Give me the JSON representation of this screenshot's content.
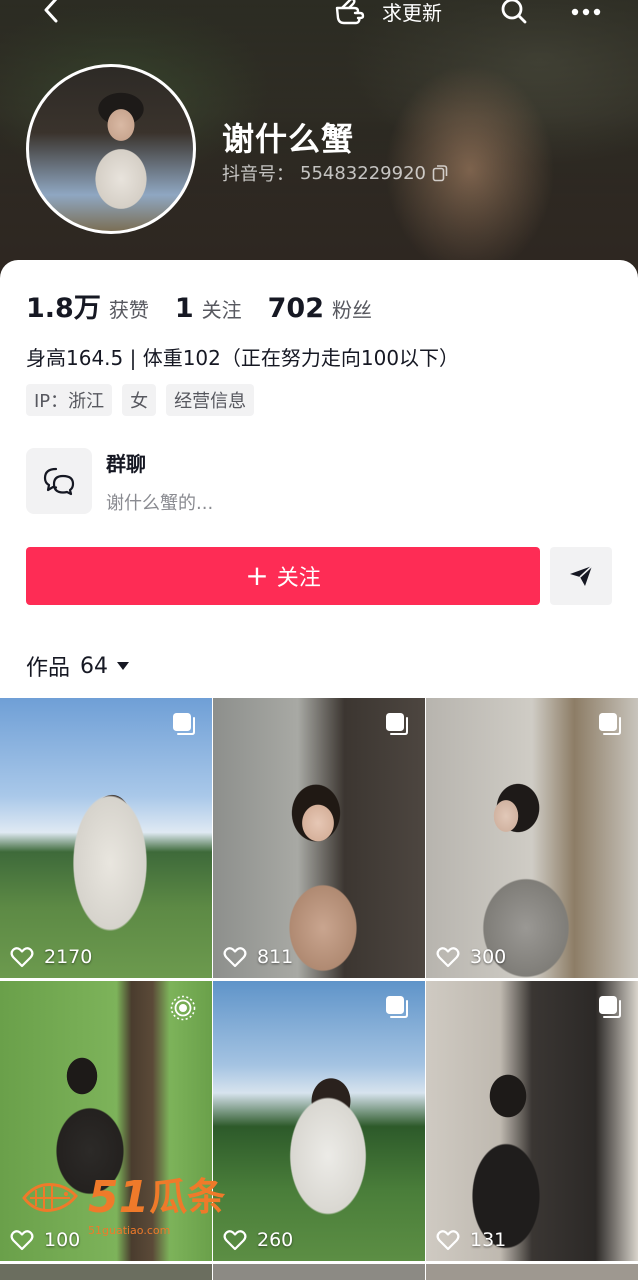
{
  "header": {
    "request_update_label": "求更新",
    "nickname": "谢什么蟹",
    "douyin_id_label": "抖音号：",
    "douyin_id": "55483229920"
  },
  "stats": {
    "likes_num": "1.8万",
    "likes_label": "获赞",
    "following_num": "1",
    "following_label": "关注",
    "followers_num": "702",
    "followers_label": "粉丝"
  },
  "bio": "身高164.5 | 体重102（正在努力走向100以下）",
  "tags": [
    "IP：浙江",
    "女",
    "经营信息"
  ],
  "group_chat": {
    "title": "群聊",
    "subtitle": "谢什么蟹的..."
  },
  "actions": {
    "follow_plus": "+",
    "follow_label": "关注"
  },
  "works": {
    "label": "作品",
    "count": "64"
  },
  "posts": [
    {
      "likes": "2170",
      "multi": true
    },
    {
      "likes": "811",
      "multi": true
    },
    {
      "likes": "300",
      "multi": true
    },
    {
      "likes": "100",
      "live_photo": true
    },
    {
      "likes": "260",
      "multi": true
    },
    {
      "likes": "131",
      "multi": true
    }
  ],
  "watermark": {
    "num": "51",
    "name": "瓜条",
    "url": "51guatiao.com"
  },
  "colors": {
    "accent": "#fe2c55",
    "text": "#161823",
    "secondary": "#57585f",
    "tag_bg": "#f2f2f3",
    "watermark": "#ef7a2a"
  },
  "icons": [
    "back-icon",
    "hand-point-icon",
    "search-icon",
    "more-icon",
    "copy-icon",
    "chat-bubbles-icon",
    "send-icon",
    "caret-down-icon",
    "multi-image-icon",
    "live-photo-icon",
    "heart-outline-icon"
  ]
}
